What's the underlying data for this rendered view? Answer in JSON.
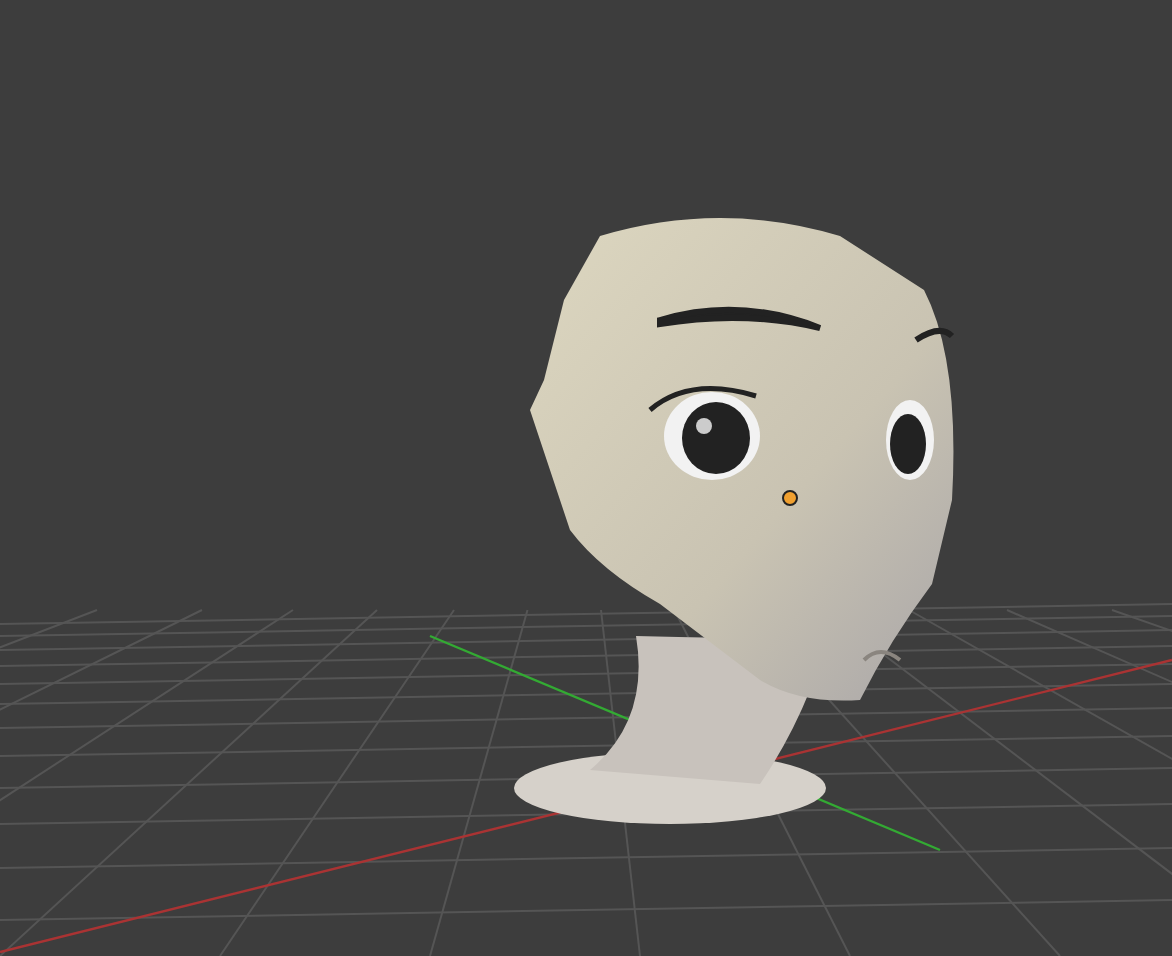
{
  "viewport": {
    "show_grid": true
  }
}
